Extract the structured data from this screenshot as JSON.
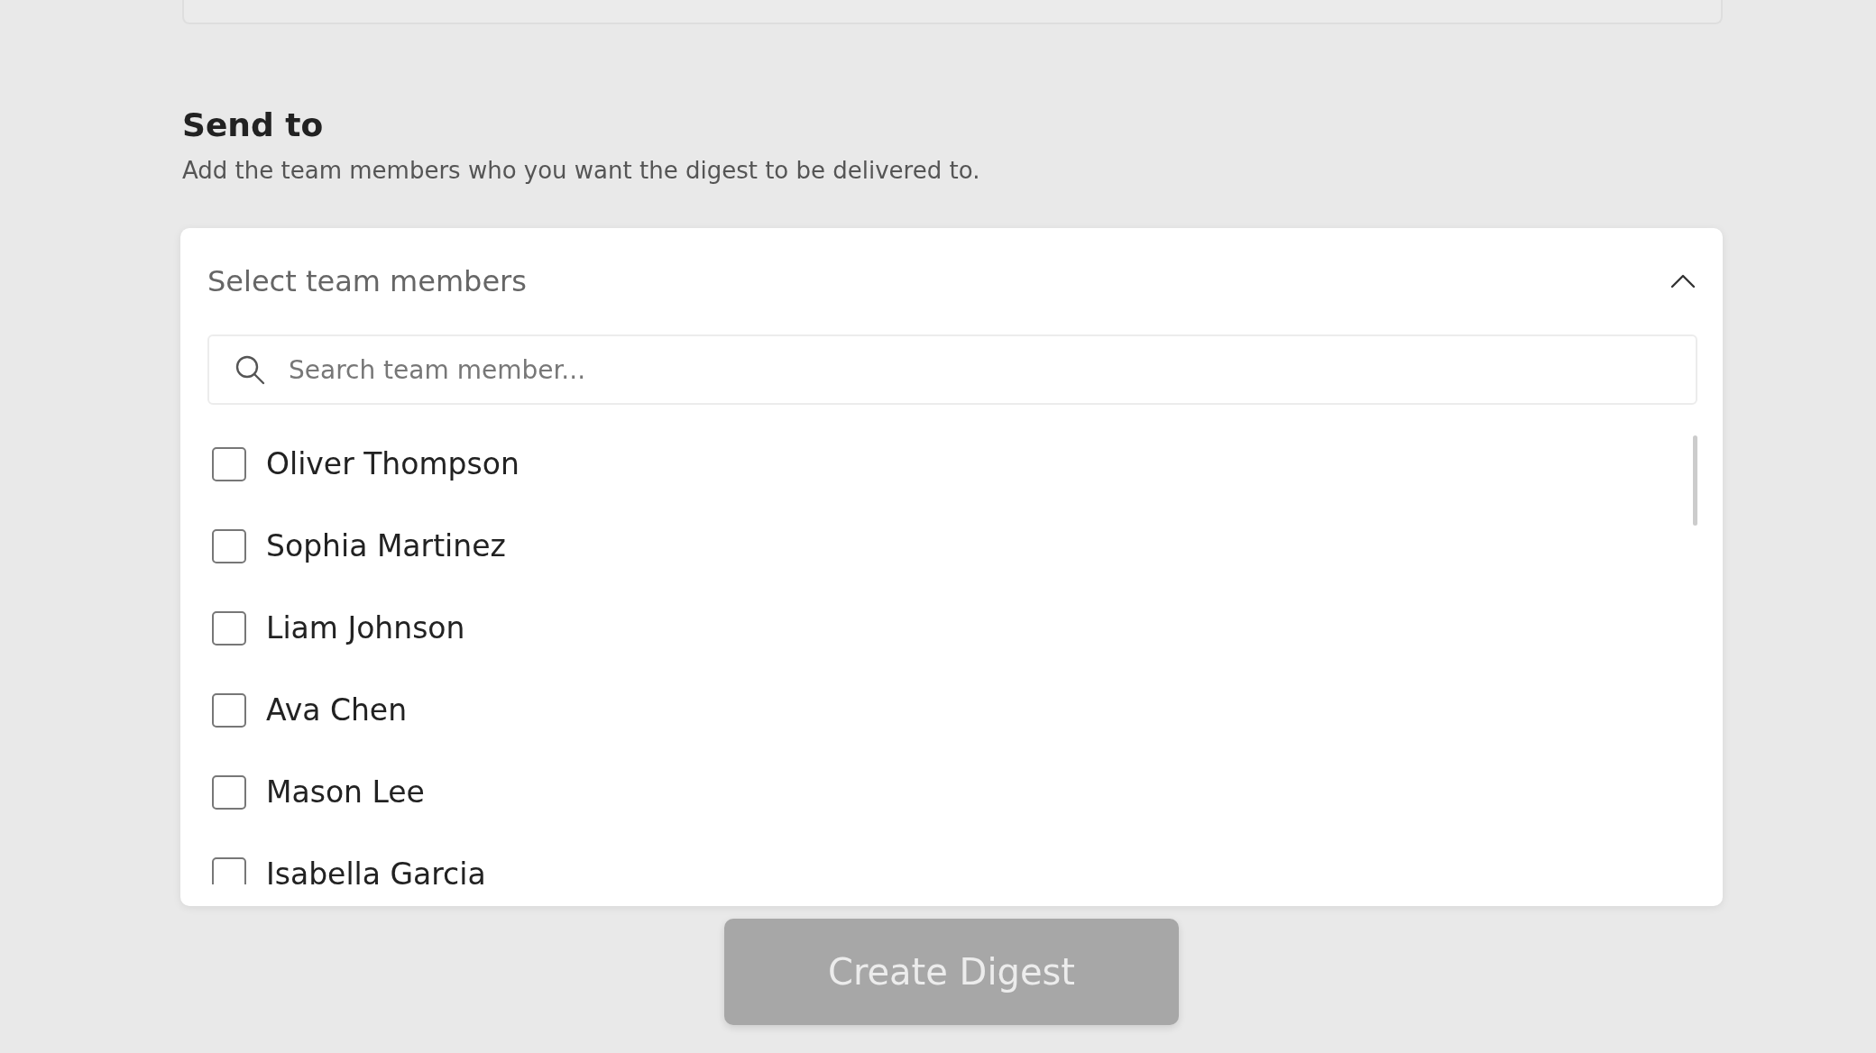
{
  "section": {
    "title": "Send to",
    "description": "Add the team members who you want the digest to be delivered to."
  },
  "dropdown": {
    "placeholder": "Select team members",
    "expanded": true,
    "search": {
      "placeholder": "Search team member..."
    },
    "members": [
      {
        "name": "Oliver Thompson",
        "checked": false
      },
      {
        "name": "Sophia Martinez",
        "checked": false
      },
      {
        "name": "Liam Johnson",
        "checked": false
      },
      {
        "name": "Ava Chen",
        "checked": false
      },
      {
        "name": "Mason Lee",
        "checked": false
      },
      {
        "name": "Isabella Garcia",
        "checked": false
      }
    ]
  },
  "button": {
    "label": "Create Digest",
    "disabled": true
  }
}
